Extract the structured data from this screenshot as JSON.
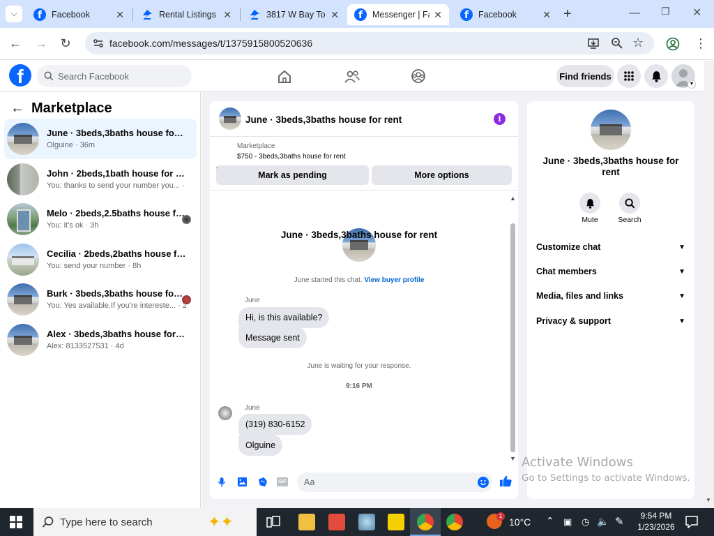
{
  "browser": {
    "tabs": [
      {
        "label": "Facebook",
        "icon": "facebook-icon"
      },
      {
        "label": "Rental Listings |",
        "icon": "zillow-icon"
      },
      {
        "label": "3817 W Bay To",
        "icon": "zillow-icon"
      },
      {
        "label": "Messenger | Fa",
        "icon": "facebook-icon",
        "active": true
      },
      {
        "label": "Facebook",
        "icon": "facebook-icon"
      }
    ],
    "url": "facebook.com/messages/t/1375915800520636"
  },
  "fb_header": {
    "search_placeholder": "Search Facebook",
    "find_friends": "Find friends"
  },
  "sidebar": {
    "title": "Marketplace",
    "conversations": [
      {
        "title": "June · 3beds,3baths house for rent",
        "sub": "Olguine · 36m",
        "selected": true
      },
      {
        "title": "John · 2beds,1bath house for rent",
        "sub": "You: thanks to send your number you... · 1h"
      },
      {
        "title": "Melo · 2beds,2.5baths house for...",
        "sub": "You: it's ok · 3h"
      },
      {
        "title": "Cecilia · 2beds,2baths house for rent",
        "sub": "You: send your number · 8h"
      },
      {
        "title": "Burk · 3beds,3baths house for re...",
        "sub": "You: Yes available.If you're intereste... · 2d"
      },
      {
        "title": "Alex · 3beds,3baths house for rent",
        "sub": "Alex: 8133527531 · 4d"
      }
    ]
  },
  "chat": {
    "header_title": "June · 3beds,3baths house for rent",
    "listing_source": "Marketplace",
    "listing_detail": "$750 - 3beds,3baths house for rent",
    "btn_pending": "Mark as pending",
    "btn_more": "More options",
    "intro_title": "June · 3beds,3baths house for rent",
    "started_text": "June started this chat.",
    "view_profile": "View buyer profile",
    "sender1": "June",
    "msg1": "Hi, is this available?",
    "msg2": "Message sent",
    "waiting": "June is waiting for your response.",
    "time": "9:16 PM",
    "sender2": "June",
    "msg3": "(319) 830-6152",
    "msg4": "Olguine",
    "composer_placeholder": "Aa"
  },
  "right_panel": {
    "title": "June · 3beds,3baths house for rent",
    "mute": "Mute",
    "search": "Search",
    "sections": [
      "Customize chat",
      "Chat members",
      "Media, files and links",
      "Privacy & support"
    ]
  },
  "watermark": {
    "line1": "Activate Windows",
    "line2": "Go to Settings to activate Windows."
  },
  "taskbar": {
    "search_placeholder": "Type here to search",
    "weather": "10°C",
    "time": "9:54 PM",
    "date": "1/23/2026",
    "notif_badge": "1"
  },
  "colors": {
    "fb_blue": "#0866ff",
    "tab_strip": "#d3e3fd",
    "purple_info": "#8a2be2"
  }
}
